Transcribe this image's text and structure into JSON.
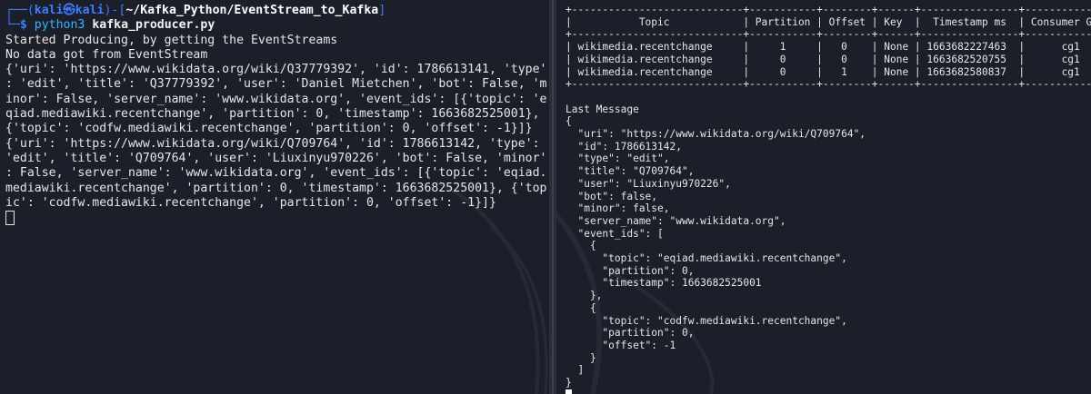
{
  "left_terminal": {
    "prompt": {
      "user": "kali",
      "host": "kali",
      "path": "~/Kafka_Python/EventStream_to_Kafka",
      "command": "python3",
      "argument": "kafka_producer.py"
    },
    "output_lines": [
      "Started Producing, by getting the EventStreams",
      "No data got from EventStream",
      "{'uri': 'https://www.wikidata.org/wiki/Q37779392', 'id': 1786613141, 'type'",
      ": 'edit', 'title': 'Q37779392', 'user': 'Daniel Mietchen', 'bot': False, 'm",
      "inor': False, 'server_name': 'www.wikidata.org', 'event_ids': [{'topic': 'e",
      "qiad.mediawiki.recentchange', 'partition': 0, 'timestamp': 1663682525001},",
      "{'topic': 'codfw.mediawiki.recentchange', 'partition': 0, 'offset': -1}]}",
      "{'uri': 'https://www.wikidata.org/wiki/Q709764', 'id': 1786613142, 'type':",
      "'edit', 'title': 'Q709764', 'user': 'Liuxinyu970226', 'bot': False, 'minor'",
      ": False, 'server_name': 'www.wikidata.org', 'event_ids': [{'topic': 'eqiad.",
      "mediawiki.recentchange', 'partition': 0, 'timestamp': 1663682525001}, {'top",
      "ic': 'codfw.mediawiki.recentchange', 'partition': 0, 'offset': -1}]}"
    ]
  },
  "right_terminal": {
    "table": {
      "border_top": "+----------------------------+-----------+--------+------+----------------+----------------+",
      "header_line": "|           Topic            | Partition | Offset | Key  |  Timestamp ms  | Consumer Group |",
      "border_mid": "+----------------------------+-----------+--------+------+----------------+----------------+",
      "rows": [
        "| wikimedia.recentchange     |     1     |   0    | None | 1663682227463  |      cg1       |",
        "| wikimedia.recentchange     |     0     |   0    | None | 1663682520755  |      cg1       |",
        "| wikimedia.recentchange     |     0     |   1    | None | 1663682580837  |      cg1       |"
      ],
      "border_bottom": "+----------------------------+-----------+--------+------+----------------+----------------+",
      "headers": [
        "Topic",
        "Partition",
        "Offset",
        "Key",
        "Timestamp ms",
        "Consumer Group"
      ]
    },
    "last_message_label": "Last Message",
    "json_lines": [
      "{",
      "  \"uri\": \"https://www.wikidata.org/wiki/Q709764\",",
      "  \"id\": 1786613142,",
      "  \"type\": \"edit\",",
      "  \"title\": \"Q709764\",",
      "  \"user\": \"Liuxinyu970226\",",
      "  \"bot\": false,",
      "  \"minor\": false,",
      "  \"server_name\": \"www.wikidata.org\",",
      "  \"event_ids\": [",
      "    {",
      "      \"topic\": \"eqiad.mediawiki.recentchange\",",
      "      \"partition\": 0,",
      "      \"timestamp\": 1663682525001",
      "    },",
      "    {",
      "      \"topic\": \"codfw.mediawiki.recentchange\",",
      "      \"partition\": 0,",
      "      \"offset\": -1",
      "    }",
      "  ]",
      "}"
    ]
  },
  "colors": {
    "background": "#1c1f2a",
    "prompt_blue": "#3d7cff",
    "text": "#e6e6e6"
  }
}
